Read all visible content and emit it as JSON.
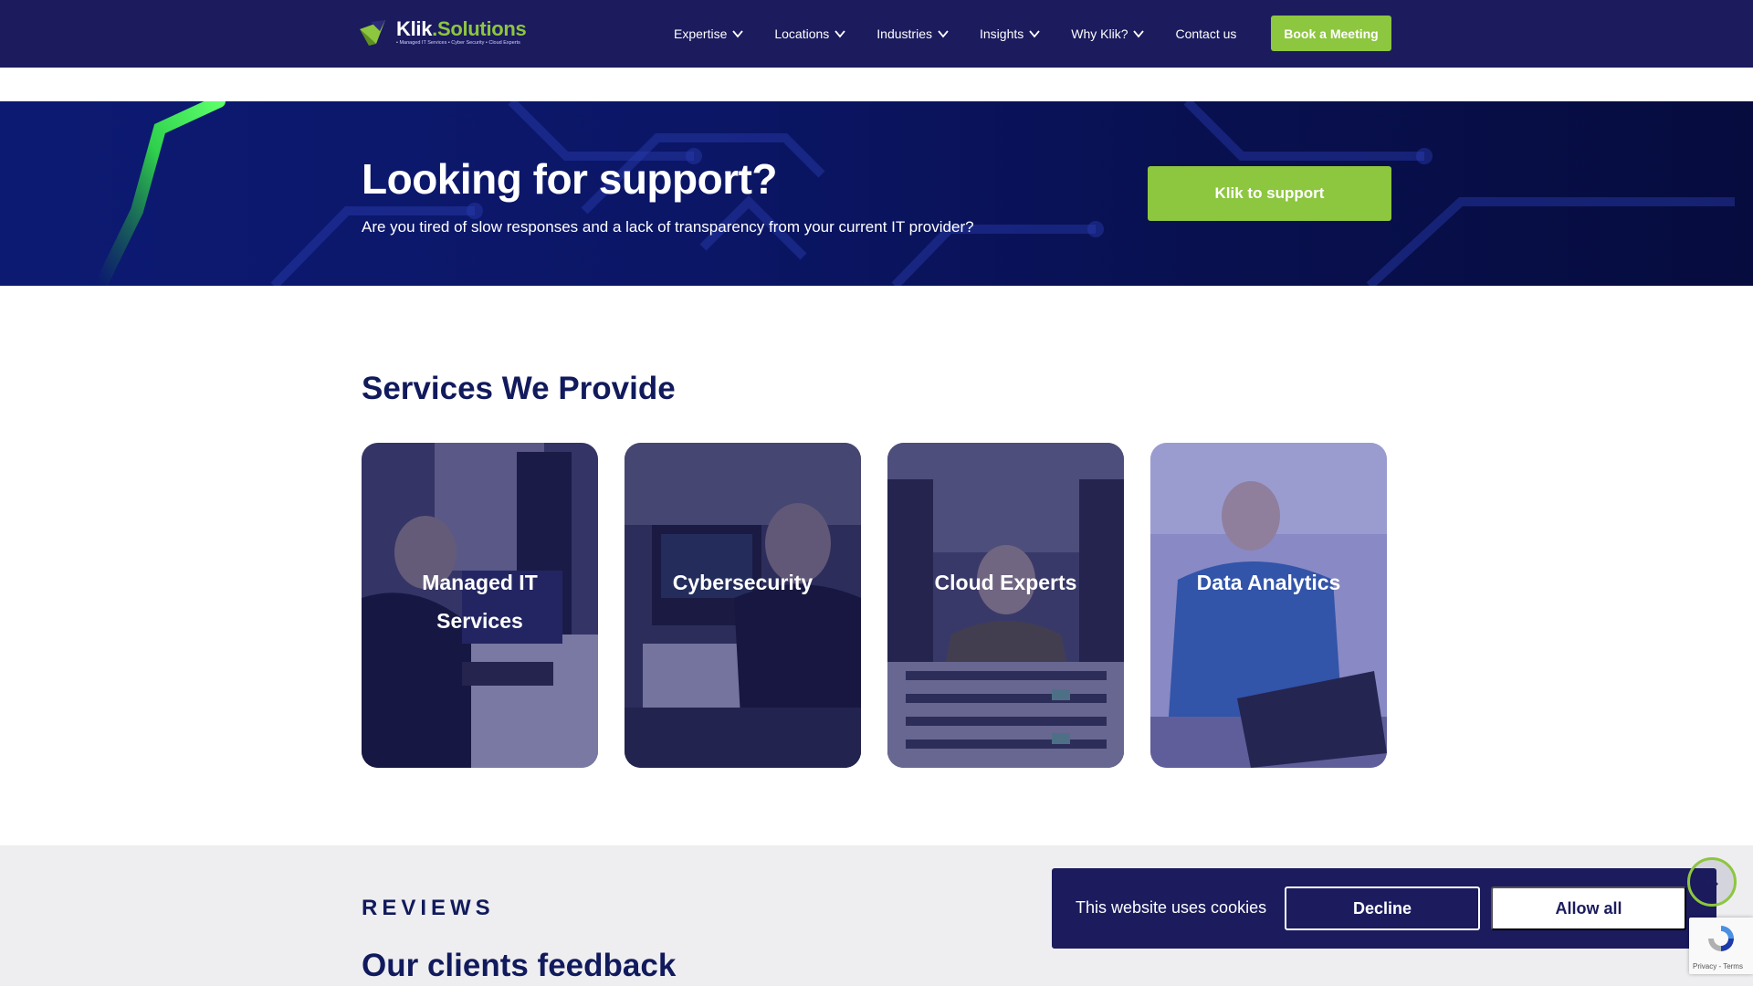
{
  "header": {
    "logo": {
      "name_main": "Klik",
      "name_accent": ".Solutions",
      "tagline": "• Managed IT Services • Cyber Security • Cloud Experts"
    },
    "nav": [
      {
        "label": "Expertise",
        "has_dropdown": true
      },
      {
        "label": "Locations",
        "has_dropdown": true
      },
      {
        "label": "Industries",
        "has_dropdown": true
      },
      {
        "label": "Insights",
        "has_dropdown": true
      },
      {
        "label": "Why Klik?",
        "has_dropdown": true
      },
      {
        "label": "Contact us",
        "has_dropdown": false
      }
    ],
    "cta_label": "Book a Meeting"
  },
  "banner": {
    "title": "Looking for support?",
    "subtitle": "Are you tired of slow responses and a lack of transparency from your current IT provider?",
    "cta_label": "Klik to support"
  },
  "services": {
    "title": "Services We Provide",
    "cards": [
      {
        "label": "Managed IT Services"
      },
      {
        "label": "Cybersecurity"
      },
      {
        "label": "Cloud Experts"
      },
      {
        "label": "Data Analytics"
      }
    ]
  },
  "reviews": {
    "eyebrow": "REVIEWS",
    "title": "Our clients feedback"
  },
  "cookie": {
    "text": "This website uses cookies",
    "decline_label": "Decline",
    "allow_label": "Allow all"
  },
  "recaptcha": {
    "links": "Privacy - Terms"
  },
  "colors": {
    "navy": "#1b1b5e",
    "heading": "#111a5c",
    "accent_green": "#8dc63f",
    "reviews_bg": "#eeeef0"
  }
}
